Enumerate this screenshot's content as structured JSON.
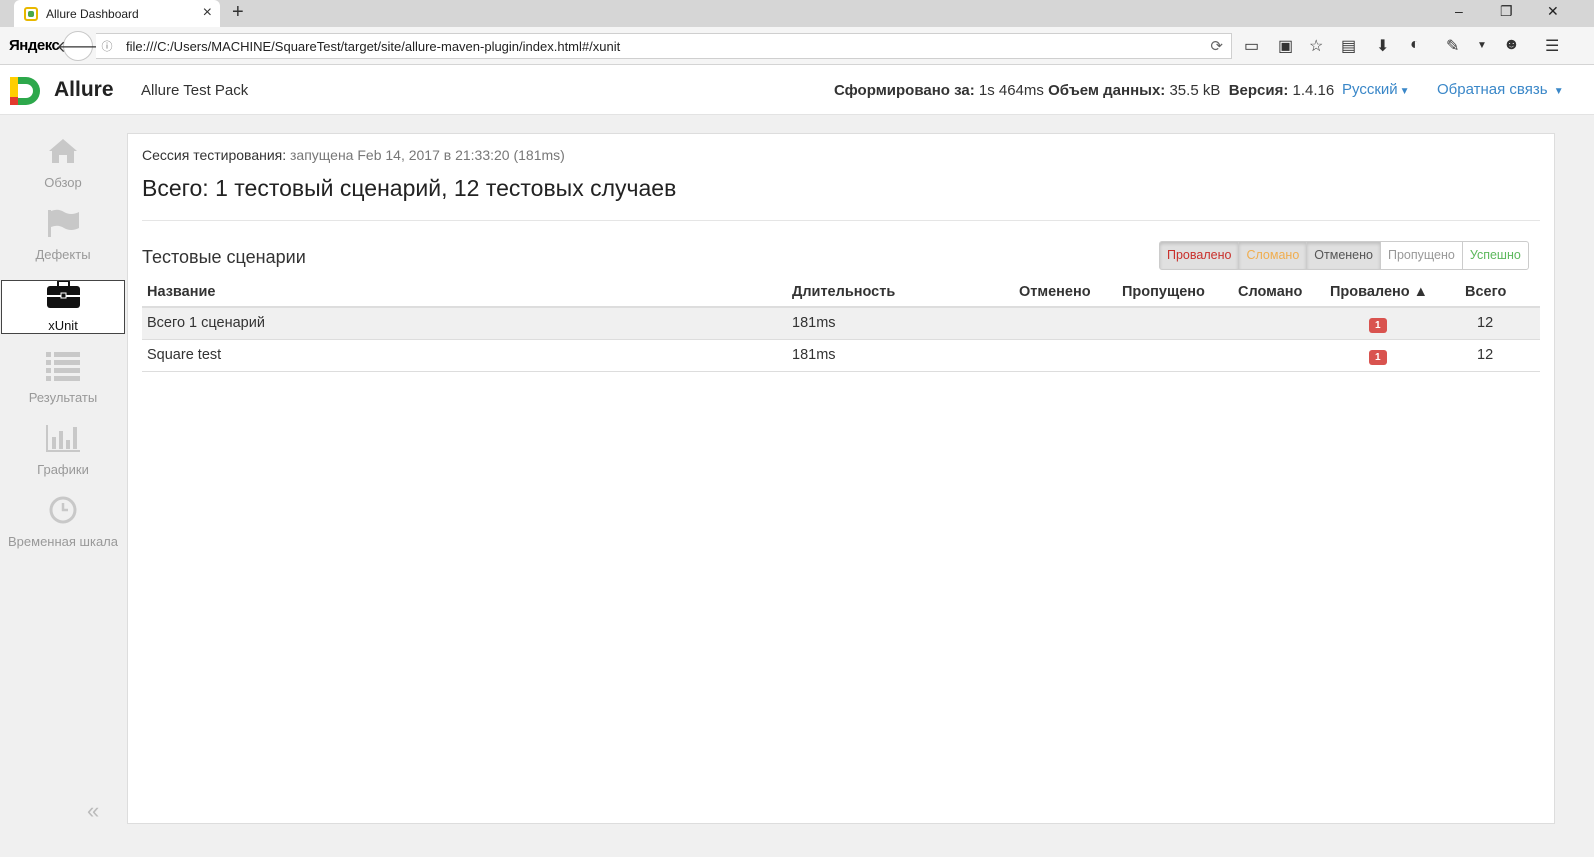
{
  "browser": {
    "tab_title": "Allure Dashboard",
    "tab_close": "×",
    "new_tab": "+",
    "brand": "Яндекс",
    "url": "file:///C:/Users/MACHINE/SquareTest/target/site/allure-maven-plugin/index.html#/xunit",
    "win_minimize": "–",
    "win_restore": "❐",
    "win_close": "✕"
  },
  "header": {
    "app_name": "Allure",
    "pack_name": "Allure Test Pack",
    "generated_label": "Сформировано за:",
    "generated_value": "1s 464ms",
    "size_label": "Объем данных:",
    "size_value": "35.5 kB",
    "version_label": "Версия:",
    "version_value": "1.4.16",
    "language": "Русский",
    "feedback": "Обратная связь"
  },
  "sidebar": {
    "items": [
      {
        "label": "Обзор",
        "icon": "home-icon"
      },
      {
        "label": "Дефекты",
        "icon": "flag-icon"
      },
      {
        "label": "xUnit",
        "icon": "briefcase-icon",
        "active": true
      },
      {
        "label": "Результаты",
        "icon": "list-icon"
      },
      {
        "label": "Графики",
        "icon": "bar-chart-icon"
      },
      {
        "label": "Временная шкала",
        "icon": "clock-icon"
      }
    ],
    "collapse": "«"
  },
  "main": {
    "session_label": "Сессия тестирования:",
    "session_value": "запущена Feb 14, 2017 в 21:33:20 (181ms)",
    "total": "Всего: 1 тестовый сценарий, 12 тестовых случаев",
    "section_title": "Тестовые сценарии",
    "filters": [
      "Провалено",
      "Сломано",
      "Отменено",
      "Пропущено",
      "Успешно"
    ],
    "columns": [
      "Название",
      "Длительность",
      "Отменено",
      "Пропущено",
      "Сломано",
      "Провалено ▲",
      "Всего"
    ],
    "rows": [
      {
        "name": "Всего 1 сценарий",
        "duration": "181ms",
        "canceled": "",
        "skipped": "",
        "broken": "",
        "failed": "1",
        "total": "12"
      },
      {
        "name": "Square test",
        "duration": "181ms",
        "canceled": "",
        "skipped": "",
        "broken": "",
        "failed": "1",
        "total": "12"
      }
    ]
  },
  "colors": {
    "failed": "#d9534f",
    "broken": "#f0ad4e",
    "passed": "#5cb85c",
    "link": "#3a87c8"
  }
}
